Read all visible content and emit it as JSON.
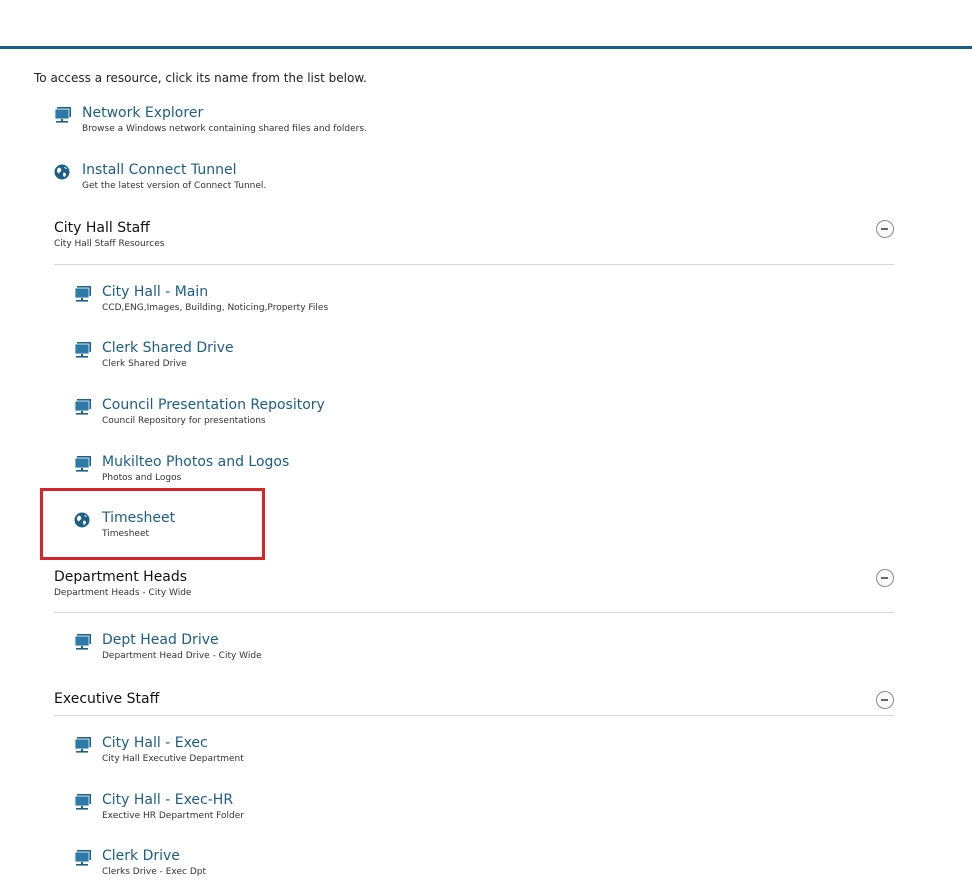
{
  "intro": "To access a resource, click its name from the list below.",
  "top_resources": [
    {
      "title": "Network Explorer",
      "desc": "Browse a Windows network containing shared files and folders.",
      "icon": "network-drive-icon"
    },
    {
      "title": "Install Connect Tunnel",
      "desc": "Get the latest version of Connect Tunnel.",
      "icon": "globe-icon"
    }
  ],
  "groups": [
    {
      "title": "City Hall Staff",
      "desc": "City Hall Staff Resources",
      "items": [
        {
          "title": "City Hall - Main",
          "desc": "CCD,ENG,Images, Building, Noticing,Property Files",
          "icon": "network-drive-icon"
        },
        {
          "title": "Clerk Shared Drive",
          "desc": "Clerk Shared Drive",
          "icon": "network-drive-icon"
        },
        {
          "title": "Council Presentation Repository",
          "desc": "Council Repository for presentations",
          "icon": "network-drive-icon"
        },
        {
          "title": "Mukilteo Photos and Logos",
          "desc": "Photos and Logos",
          "icon": "network-drive-icon"
        },
        {
          "title": "Timesheet",
          "desc": "Timesheet",
          "icon": "globe-icon"
        }
      ]
    },
    {
      "title": "Department Heads",
      "desc": "Department Heads - City Wide",
      "items": [
        {
          "title": "Dept Head Drive",
          "desc": "Department Head Drive - City Wide",
          "icon": "network-drive-icon"
        }
      ]
    },
    {
      "title": "Executive Staff",
      "desc": "",
      "items": [
        {
          "title": "City Hall - Exec",
          "desc": "City Hall Executive Department",
          "icon": "network-drive-icon"
        },
        {
          "title": "City Hall - Exec-HR",
          "desc": "Exective HR Department Folder",
          "icon": "network-drive-icon"
        },
        {
          "title": "Clerk Drive",
          "desc": "Clerks Drive - Exec Dpt",
          "icon": "network-drive-icon"
        }
      ]
    }
  ],
  "colors": {
    "accent": "#1b5d86",
    "link": "#1f5d80",
    "highlight": "#d9232b"
  }
}
